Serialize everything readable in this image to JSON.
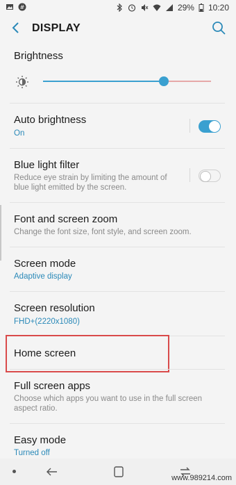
{
  "status": {
    "battery": "29%",
    "time": "10:20"
  },
  "header": {
    "title": "DISPLAY"
  },
  "brightness": {
    "label": "Brightness",
    "level": 0.72
  },
  "items": [
    {
      "title": "Auto brightness",
      "subtitle": "On",
      "toggle": true
    },
    {
      "title": "Blue light filter",
      "subtitle": "Reduce eye strain by limiting the amount of blue light emitted by the screen.",
      "toggle": false
    },
    {
      "title": "Font and screen zoom",
      "subtitle": "Change the font size, font style, and screen zoom."
    },
    {
      "title": "Screen mode",
      "subtitle": "Adaptive display"
    },
    {
      "title": "Screen resolution",
      "subtitle": "FHD+(2220x1080)"
    },
    {
      "title": "Home screen"
    },
    {
      "title": "Full screen apps",
      "subtitle": "Choose which apps you want to use in the full screen aspect ratio."
    },
    {
      "title": "Easy mode",
      "subtitle": "Turned off"
    }
  ],
  "watermark": "www.989214.com",
  "colors": {
    "accent": "#3aa0d0",
    "highlight": "#d94a4a"
  }
}
